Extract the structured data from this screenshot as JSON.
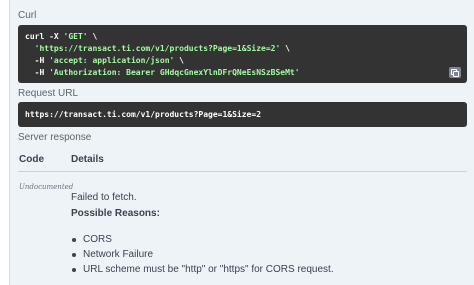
{
  "curl_section": {
    "label": "Curl",
    "lines": [
      {
        "prefix": "curl -X ",
        "str": "'GET'",
        "suffix": " \\"
      },
      {
        "prefix": "  ",
        "str": "'https://transact.ti.com/v1/products?Page=1&Size=2'",
        "suffix": " \\"
      },
      {
        "prefix": "  -H ",
        "str": "'accept: application/json'",
        "suffix": " \\"
      },
      {
        "prefix": "  -H ",
        "str": "'Authorization: Bearer GHdqcGnexYlnDFrQNeEsNSzBSeMt'",
        "suffix": ""
      }
    ],
    "copy_icon": "copy-icon"
  },
  "request_url_section": {
    "label": "Request URL",
    "url": "https://transact.ti.com/v1/products?Page=1&Size=2"
  },
  "server_response": {
    "label": "Server response",
    "columns": [
      "Code",
      "Details"
    ],
    "row": {
      "code": "Undocumented",
      "message": "Failed to fetch.",
      "reasons_title": "Possible Reasons:",
      "reasons": [
        "CORS",
        "Network Failure",
        "URL scheme must be \"http\" or \"https\" for CORS request."
      ]
    }
  },
  "colors": {
    "panel_bg": "#eef3f8",
    "code_bg": "#333333",
    "string_green": "#a2fca2",
    "text": "#3b4151"
  }
}
